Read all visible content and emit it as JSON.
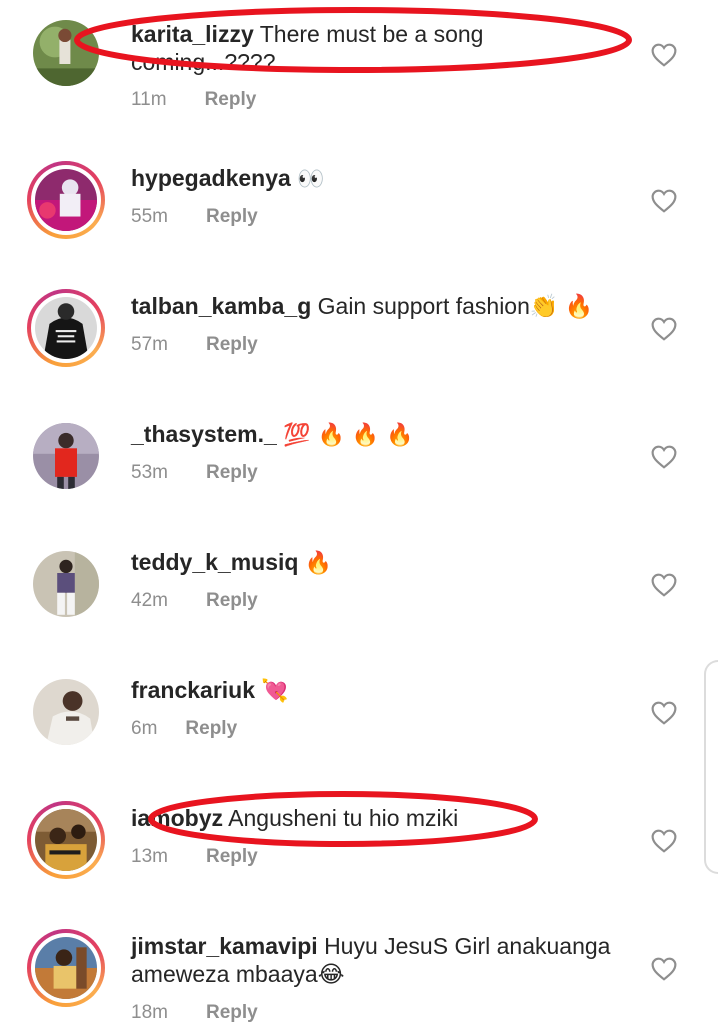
{
  "comments": [
    {
      "username": "karita_lizzy",
      "text": "There must be a song coming...????",
      "time": "11m",
      "reply": "Reply",
      "ring": false,
      "annotated": true
    },
    {
      "username": "hypegadkenya",
      "text": "👀",
      "time": "55m",
      "reply": "Reply",
      "ring": true
    },
    {
      "username": "talban_kamba_g",
      "text": "Gain support fashion👏 🔥",
      "time": "57m",
      "reply": "Reply",
      "ring": true
    },
    {
      "username": "_thasystem._",
      "text": "💯 🔥 🔥 🔥",
      "time": "53m",
      "reply": "Reply",
      "ring": false
    },
    {
      "username": "teddy_k_musiq",
      "text": "🔥",
      "time": "42m",
      "reply": "Reply",
      "ring": false
    },
    {
      "username": "franckariuk",
      "text": "💘",
      "time": "6m",
      "reply": "Reply",
      "ring": false
    },
    {
      "username": "iamobyz",
      "text": "Angusheni tu hio mziki",
      "time": "13m",
      "reply": "Reply",
      "ring": true,
      "annotated": true
    },
    {
      "username": "jimstar_kamavipi",
      "text": "Huyu JesuS Girl anakuanga ameweza mbaaya😂",
      "time": "18m",
      "reply": "Reply",
      "ring": true
    }
  ],
  "icons": {
    "like": "heart-outline-icon"
  },
  "colors": {
    "annotation": "#e8141f",
    "muted": "#8e8e8e",
    "text": "#262626"
  }
}
